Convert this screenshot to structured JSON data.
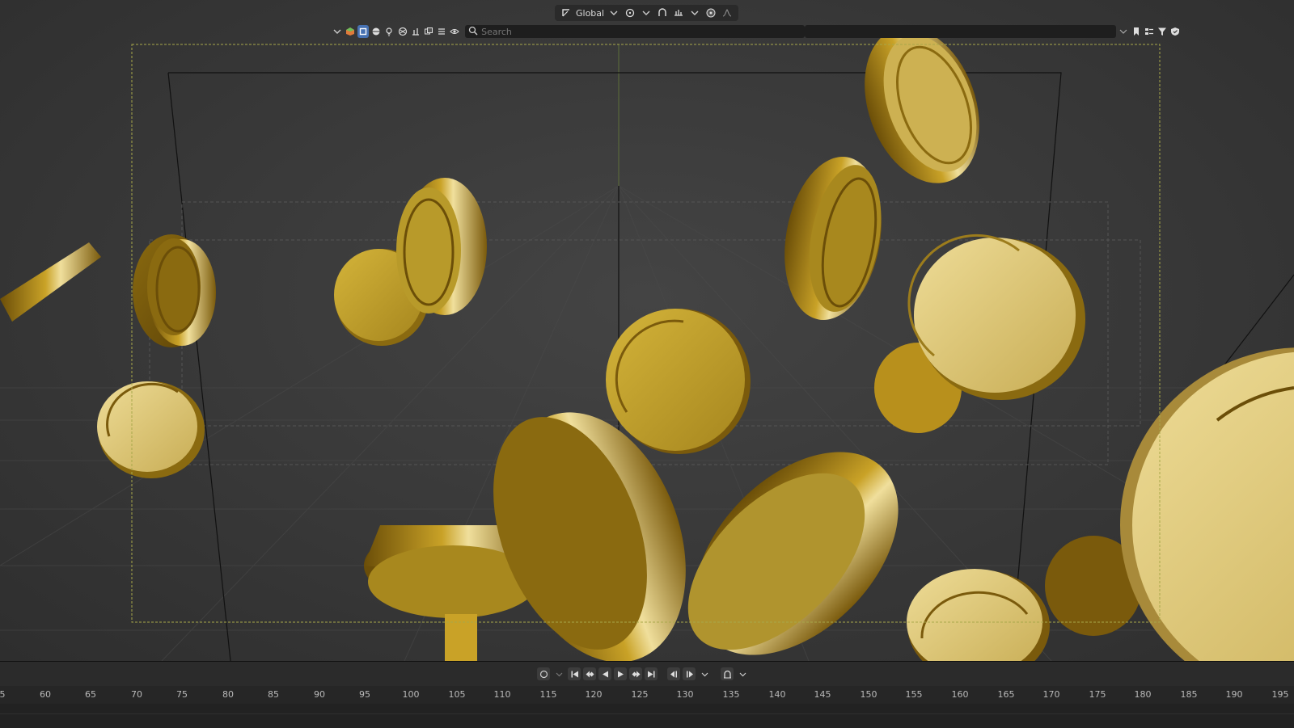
{
  "header": {
    "transform_orientation": "Global",
    "icons": [
      "transform-orientation-icon",
      "pivot-icon",
      "snap-icon",
      "snap-target-icon",
      "proportional-editing-icon",
      "falloff-icon"
    ]
  },
  "outliner": {
    "search_placeholder": "Search",
    "selected_mode": "object-mode"
  },
  "timeline": {
    "ticks": [
      "5",
      "60",
      "65",
      "70",
      "75",
      "80",
      "85",
      "90",
      "95",
      "100",
      "105",
      "110",
      "115",
      "120",
      "125",
      "130",
      "135",
      "140",
      "145",
      "150",
      "155",
      "160",
      "165",
      "170",
      "175",
      "180",
      "185",
      "190",
      "195"
    ]
  },
  "colors": {
    "accent": "#4772b3",
    "camera_frame": "#a8a84a",
    "gold_light": "#e8d48a",
    "gold_mid": "#c9a227",
    "gold_dark": "#6b4e08"
  }
}
